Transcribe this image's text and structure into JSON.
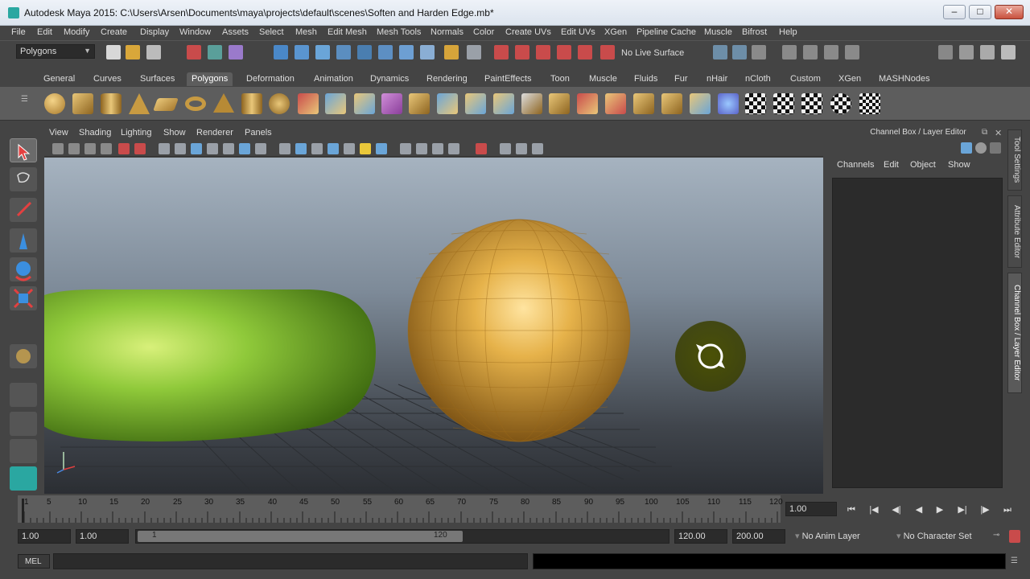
{
  "window": {
    "title": "Autodesk Maya 2015: C:\\Users\\Arsen\\Documents\\maya\\projects\\default\\scenes\\Soften and Harden Edge.mb*",
    "controls": [
      "–",
      "□",
      "✕"
    ]
  },
  "menubar": {
    "items": [
      "File",
      "Edit",
      "Modify",
      "Create",
      "Display",
      "Window",
      "Assets",
      "Select",
      "Mesh",
      "Edit Mesh",
      "Mesh Tools",
      "Normals",
      "Color",
      "Create UVs",
      "Edit UVs",
      "XGen",
      "Pipeline Cache",
      "Muscle",
      "Bifrost",
      "Help"
    ]
  },
  "statusline": {
    "mode": "Polygons",
    "live_surface": "No Live Surface"
  },
  "shelf": {
    "tabs": [
      "General",
      "Curves",
      "Surfaces",
      "Polygons",
      "Deformation",
      "Animation",
      "Dynamics",
      "Rendering",
      "PaintEffects",
      "Toon",
      "Muscle",
      "Fluids",
      "Fur",
      "nHair",
      "nCloth",
      "Custom",
      "XGen",
      "MASHNodes"
    ],
    "active_tab": "Polygons"
  },
  "panel": {
    "menus": [
      "View",
      "Shading",
      "Lighting",
      "Show",
      "Renderer",
      "Panels"
    ]
  },
  "channel_box": {
    "title": "Channel Box / Layer Editor",
    "menus": [
      "Channels",
      "Edit",
      "Object",
      "Show"
    ]
  },
  "side_tabs": [
    "Tool Settings",
    "Attribute Editor",
    "Channel Box / Layer Editor"
  ],
  "timeline": {
    "tick_labels": [
      "1",
      "5",
      "10",
      "15",
      "20",
      "25",
      "30",
      "35",
      "40",
      "45",
      "50",
      "55",
      "60",
      "65",
      "70",
      "75",
      "80",
      "85",
      "90",
      "95",
      "100",
      "105",
      "110",
      "115",
      "120"
    ],
    "current_time": "1.00",
    "playback_buttons": [
      "⏮",
      "|◀",
      "◀|",
      "◀",
      "▶",
      "▶|",
      "|▶",
      "⏭"
    ]
  },
  "range": {
    "start": "1.00",
    "playback_start": "1.00",
    "slider_start": "1",
    "slider_end": "120",
    "playback_end": "120.00",
    "end": "200.00",
    "anim_layer": "No Anim Layer",
    "character_set": "No Character Set"
  },
  "command_line": {
    "label": "MEL"
  },
  "colors": {
    "capsule": "#8fc93a",
    "sphere": "#e6b24a",
    "accent": "#5d5d5d"
  }
}
